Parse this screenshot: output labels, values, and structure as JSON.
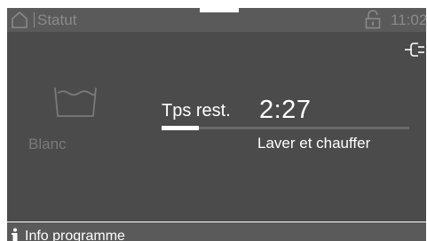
{
  "header": {
    "title": "Statut",
    "time": "11:02",
    "icons": {
      "home": "home-icon",
      "lock": "lock-icon"
    }
  },
  "status": {
    "connection_icon": "plug-icon"
  },
  "program": {
    "icon": "wash-tub-icon",
    "name": "Blanc"
  },
  "progress": {
    "label": "Tps rest.",
    "remaining": "2:27",
    "fraction": 0.15,
    "phase": "Laver et chauffer"
  },
  "footer": {
    "info_label": "Info programme",
    "icon": "info-icon"
  },
  "colors": {
    "bar_background": "#5a5a5a",
    "panel_background": "#4b4b4b",
    "text_primary": "#ffffff",
    "text_dim": "#8a8a8a"
  }
}
